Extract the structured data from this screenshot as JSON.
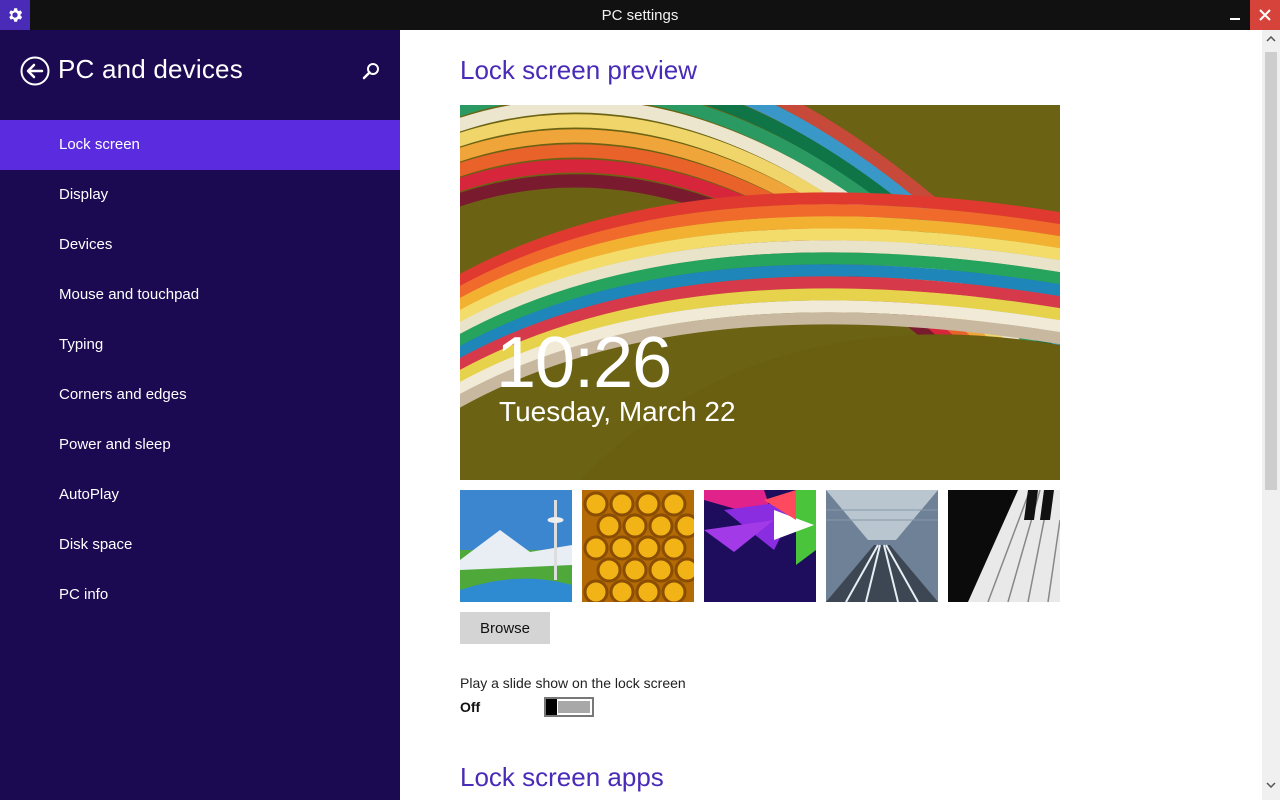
{
  "window": {
    "title": "PC settings",
    "accent": "#4a2bb8",
    "close_color": "#d6433a"
  },
  "sidebar": {
    "title": "PC and devices",
    "background": "#1b0a52",
    "active_color": "#5b2be0",
    "back_icon": "back-arrow-icon",
    "search_icon": "search-icon",
    "items": [
      {
        "label": "Lock screen",
        "active": true
      },
      {
        "label": "Display"
      },
      {
        "label": "Devices"
      },
      {
        "label": "Mouse and touchpad"
      },
      {
        "label": "Typing"
      },
      {
        "label": "Corners and edges"
      },
      {
        "label": "Power and sleep"
      },
      {
        "label": "AutoPlay"
      },
      {
        "label": "Disk space"
      },
      {
        "label": "PC info"
      }
    ]
  },
  "main": {
    "preview_heading": "Lock screen preview",
    "preview": {
      "time": "10:26",
      "date": "Tuesday, March 22"
    },
    "thumbnails": [
      "space-needle-mountain",
      "honeycomb",
      "purple-geometric",
      "train-tracks",
      "piano-keys"
    ],
    "browse_label": "Browse",
    "slideshow": {
      "label": "Play a slide show on the lock screen",
      "state": "Off"
    },
    "apps_heading": "Lock screen apps"
  }
}
